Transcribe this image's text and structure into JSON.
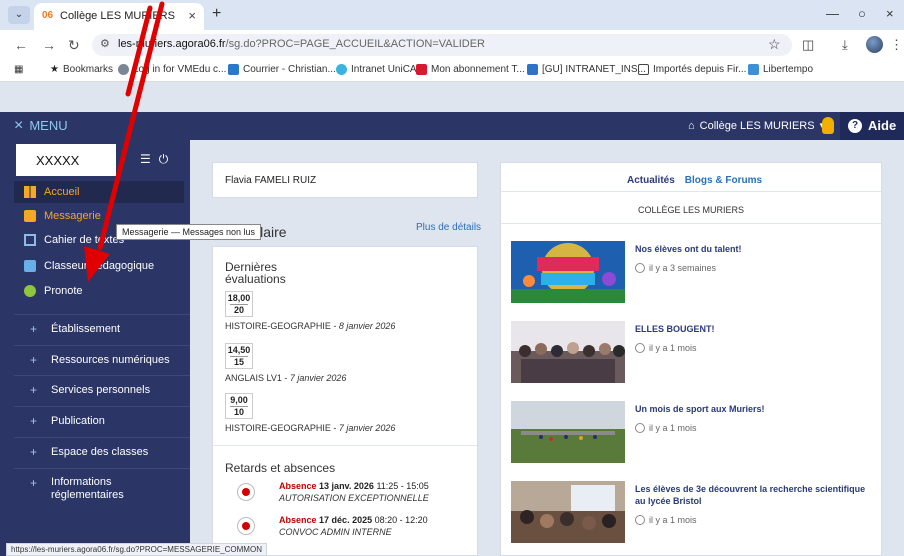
{
  "browser": {
    "tab_favicon": "06",
    "tab_title": "Collège LES MURIERS",
    "url_host": "les-muriers.agora06.fr",
    "url_path": "/sg.do?PROC=PAGE_ACCUEIL&ACTION=VALIDER",
    "bookmarks": [
      "Bookmarks",
      "Log in for VMEdu c...",
      "Courrier - Christian...",
      "Intranet UniCA",
      "Mon abonnement T...",
      "[GU] INTRANET_INS...",
      "Importés depuis Fir...",
      "Libertempo"
    ],
    "status_url": "https://les-muriers.agora06.fr/sg.do?PROC=MESSAGERIE_COMMON"
  },
  "header": {
    "menu_label": "MENU",
    "college": "Collège LES MURIERS",
    "help": "Aide"
  },
  "sidebar": {
    "user": "XXXXX",
    "items": [
      {
        "label": "Accueil",
        "icon": "grid-icon"
      },
      {
        "label": "Messagerie",
        "icon": "envelope-icon"
      },
      {
        "label": "Cahier de textes",
        "icon": "book-icon"
      },
      {
        "label": "Classeur pédagogique",
        "icon": "folder-icon"
      },
      {
        "label": "Pronote",
        "icon": "pronote-icon"
      }
    ],
    "groups": [
      "Établissement",
      "Ressources numériques",
      "Services personnels",
      "Publication",
      "Espace des classes",
      "Informations réglementaires"
    ],
    "tooltip": "Messagerie — Messages non lus"
  },
  "main": {
    "student_name": "Flavia FAMELI RUIZ",
    "scolaire_title": "Scolaire",
    "more_link": "Plus de détails",
    "evaluations_title": "Dernières évaluations",
    "evaluations": [
      {
        "grade": "18,00",
        "scale": "20",
        "subject": "HISTOIRE-GEOGRAPHIE",
        "date": "8 janvier 2026"
      },
      {
        "grade": "14,50",
        "scale": "15",
        "subject": "ANGLAIS LV1",
        "date": "7 janvier 2026"
      },
      {
        "grade": "9,00",
        "scale": "10",
        "subject": "HISTOIRE-GEOGRAPHIE",
        "date": "7 janvier 2026"
      }
    ],
    "absences_title": "Retards et absences",
    "absences": [
      {
        "type": "Absence",
        "date": "13 janv. 2026",
        "time": "11:25 - 15:05",
        "reason": "AUTORISATION EXCEPTIONNELLE"
      },
      {
        "type": "Absence",
        "date": "17 déc. 2025",
        "time": "08:20 - 12:20",
        "reason": "CONVOC ADMIN INTERNE"
      }
    ]
  },
  "news": {
    "tab_active": "Actualités",
    "tab_other": "Blogs & Forums",
    "college": "COLLÈGE LES MURIERS",
    "items": [
      {
        "title": "Nos élèves ont du talent!",
        "time": "il y a 3 semaines"
      },
      {
        "title": "ELLES BOUGENT!",
        "time": "il y a 1 mois"
      },
      {
        "title": "Un mois de sport aux Muriers!",
        "time": "il y a 1 mois"
      },
      {
        "title": "Les élèves de 3e découvrent la recherche scientifique au lycée Bristol",
        "time": "il y a 1 mois"
      }
    ]
  },
  "colors": {
    "sidebar": "#2b3566",
    "accent": "#f4a823",
    "absence": "#c00000",
    "arrow": "#e00000"
  }
}
